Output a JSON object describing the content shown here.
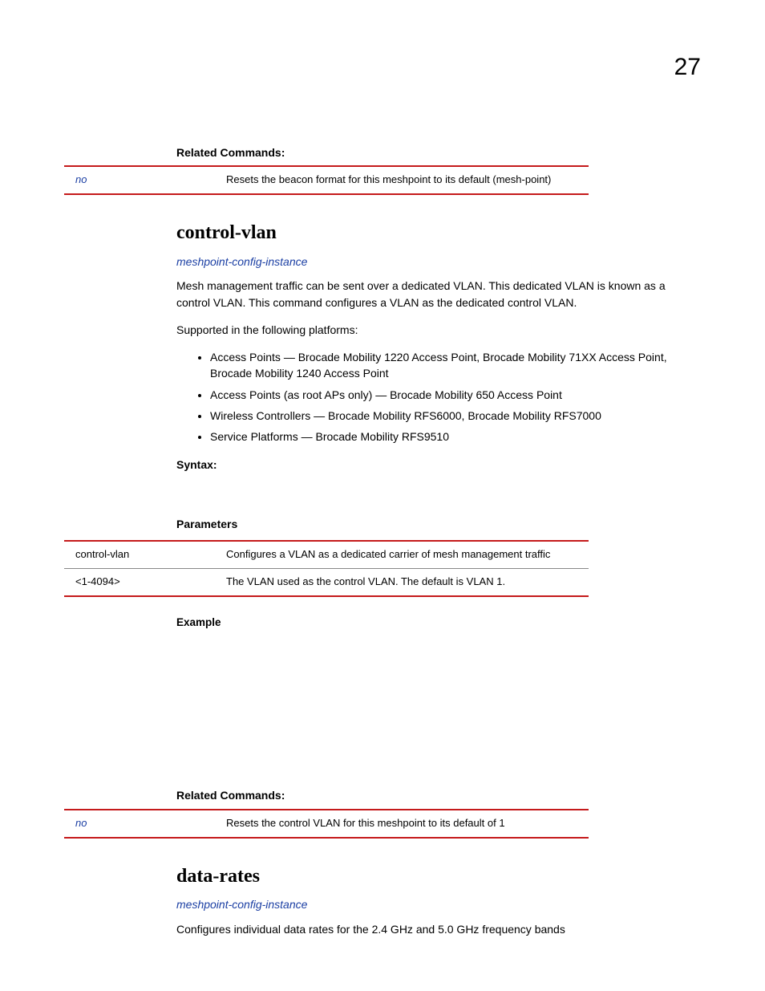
{
  "page_number": "27",
  "section1": {
    "related_heading": "Related Commands:",
    "tbl_cmd": "no",
    "tbl_desc": "Resets the beacon format for this meshpoint to its default (mesh-point)"
  },
  "section2": {
    "title": "control-vlan",
    "breadcrumb": "meshpoint-config-instance",
    "intro": "Mesh management traffic can be sent over a dedicated VLAN. This dedicated VLAN is known as a control VLAN. This command configures a VLAN as the dedicated control VLAN.",
    "supported_heading": "Supported in the following platforms:",
    "bullets": [
      "Access Points — Brocade Mobility 1220 Access Point, Brocade Mobility 71XX Access Point, Brocade Mobility 1240 Access Point",
      "Access Points (as root APs only) — Brocade Mobility 650 Access Point",
      "Wireless Controllers — Brocade Mobility RFS6000, Brocade Mobility RFS7000",
      "Service Platforms — Brocade Mobility RFS9510"
    ],
    "syntax_heading": "Syntax:",
    "params_heading": "Parameters",
    "params": [
      {
        "cmd": "control-vlan",
        "desc": "Configures a VLAN as a dedicated carrier of mesh management traffic"
      },
      {
        "cmd": "<1-4094>",
        "desc": "The VLAN used as the control VLAN. The default is VLAN 1."
      }
    ],
    "example_heading": "Example",
    "related_heading": "Related Commands:",
    "rel_cmd": "no",
    "rel_desc": "Resets the control VLAN for this meshpoint to its default of 1"
  },
  "section3": {
    "title": "data-rates",
    "breadcrumb": "meshpoint-config-instance",
    "intro": "Configures individual data rates for the 2.4 GHz and 5.0 GHz frequency bands"
  }
}
